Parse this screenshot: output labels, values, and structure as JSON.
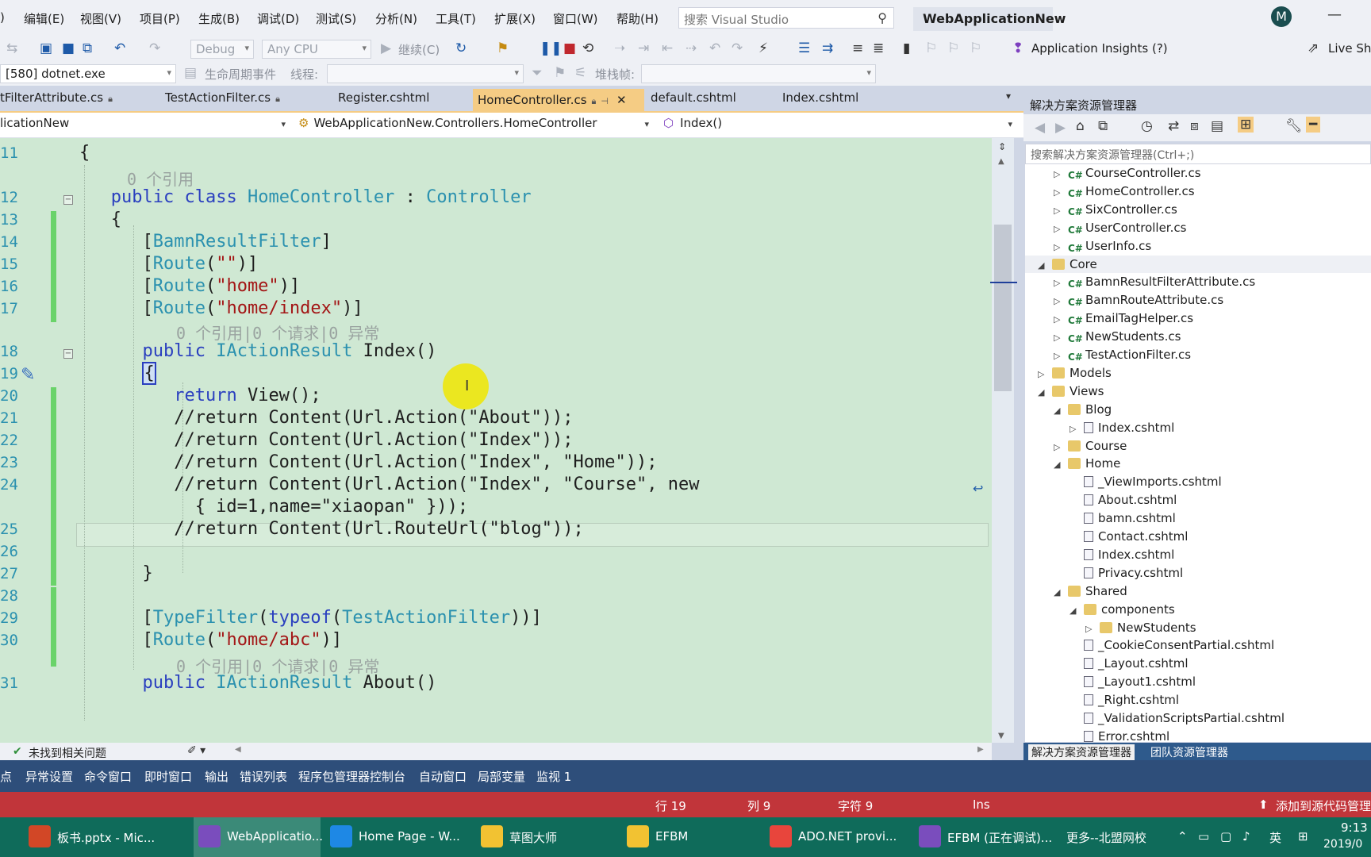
{
  "menu": {
    "items": [
      ")",
      "编辑(E)",
      "视图(V)",
      "项目(P)",
      "生成(B)",
      "调试(D)",
      "测试(S)",
      "分析(N)",
      "工具(T)",
      "扩展(X)",
      "窗口(W)",
      "帮助(H)"
    ],
    "search_placeholder": "搜索 Visual Studio",
    "project_name": "WebApplicationNew",
    "avatar_initial": "M"
  },
  "toolbar": {
    "config": "Debug",
    "platform": "Any CPU",
    "continue_label": "继续(C)",
    "insights_label": "Application Insights (?)",
    "live_share": "Live Sha",
    "process": "[580] dotnet.exe",
    "lifecycle_label": "生命周期事件",
    "thread_label": "线程:",
    "stack_label": "堆栈帧:"
  },
  "tabs": [
    {
      "label": "tFilterAttribute.cs",
      "pinned": true
    },
    {
      "label": "TestActionFilter.cs",
      "pinned": true
    },
    {
      "label": "Register.cshtml",
      "pinned": false
    },
    {
      "label": "HomeController.cs",
      "pinned": true,
      "active": true
    },
    {
      "label": "default.cshtml",
      "pinned": false
    },
    {
      "label": "Index.cshtml",
      "pinned": false
    }
  ],
  "navbar": {
    "project": "licationNew",
    "class": "WebApplicationNew.Controllers.HomeController",
    "member": "Index()"
  },
  "code": {
    "line_numbers": [
      "11",
      "12",
      "13",
      "14",
      "15",
      "16",
      "17",
      "18",
      "19",
      "20",
      "21",
      "22",
      "23",
      "24",
      "25",
      "26",
      "27",
      "28",
      "29",
      "30",
      "31"
    ],
    "lens_class": "0 个引用",
    "lens_method": "0 个引用|0 个请求|0 异常",
    "lens_method2": "0 个引用|0 个请求|0 异常"
  },
  "solution": {
    "title": "解决方案资源管理器",
    "search_placeholder": "搜索解决方案资源管理器(Ctrl+;)",
    "items": [
      {
        "label": "CourseController.cs",
        "type": "cs",
        "expander": "▷"
      },
      {
        "label": "HomeController.cs",
        "type": "cs",
        "expander": "▷"
      },
      {
        "label": "SixController.cs",
        "type": "cs",
        "expander": "▷"
      },
      {
        "label": "UserController.cs",
        "type": "cs",
        "expander": "▷"
      },
      {
        "label": "UserInfo.cs",
        "type": "cs",
        "expander": "▷"
      },
      {
        "label": "Core",
        "type": "folder",
        "expander": "◢"
      },
      {
        "label": "BamnResultFilterAttribute.cs",
        "type": "cs",
        "expander": "▷"
      },
      {
        "label": "BamnRouteAttribute.cs",
        "type": "cs",
        "expander": "▷"
      },
      {
        "label": "EmailTagHelper.cs",
        "type": "cs",
        "expander": "▷"
      },
      {
        "label": "NewStudents.cs",
        "type": "cs",
        "expander": "▷"
      },
      {
        "label": "TestActionFilter.cs",
        "type": "cs",
        "expander": "▷"
      },
      {
        "label": "Models",
        "type": "folder",
        "expander": "▷"
      },
      {
        "label": "Views",
        "type": "folder",
        "expander": "◢"
      },
      {
        "label": "Blog",
        "type": "folder",
        "expander": "◢"
      },
      {
        "label": "Index.cshtml",
        "type": "page",
        "expander": "▷"
      },
      {
        "label": "Course",
        "type": "folder",
        "expander": "▷"
      },
      {
        "label": "Home",
        "type": "folder",
        "expander": "◢"
      },
      {
        "label": "_ViewImports.cshtml",
        "type": "page",
        "expander": ""
      },
      {
        "label": "About.cshtml",
        "type": "page",
        "expander": ""
      },
      {
        "label": "bamn.cshtml",
        "type": "page",
        "expander": ""
      },
      {
        "label": "Contact.cshtml",
        "type": "page",
        "expander": ""
      },
      {
        "label": "Index.cshtml",
        "type": "page",
        "expander": ""
      },
      {
        "label": "Privacy.cshtml",
        "type": "page",
        "expander": ""
      },
      {
        "label": "Shared",
        "type": "folder",
        "expander": "◢"
      },
      {
        "label": "components",
        "type": "folder",
        "expander": "◢"
      },
      {
        "label": "NewStudents",
        "type": "folder",
        "expander": "▷"
      },
      {
        "label": "_CookieConsentPartial.cshtml",
        "type": "page",
        "expander": ""
      },
      {
        "label": "_Layout.cshtml",
        "type": "page",
        "expander": ""
      },
      {
        "label": "_Layout1.cshtml",
        "type": "page",
        "expander": ""
      },
      {
        "label": "_Right.cshtml",
        "type": "page",
        "expander": ""
      },
      {
        "label": "_ValidationScriptsPartial.cshtml",
        "type": "page",
        "expander": ""
      },
      {
        "label": "Error.cshtml",
        "type": "page",
        "expander": ""
      }
    ],
    "bottom_tabs": [
      "解决方案资源管理器",
      "团队资源管理器"
    ]
  },
  "editor_status": {
    "issues": "未找到相关问题"
  },
  "tool_tabs": [
    "点",
    "异常设置",
    "命令窗口",
    "即时窗口",
    "输出",
    "错误列表",
    "程序包管理器控制台",
    "自动窗口",
    "局部变量",
    "监视 1"
  ],
  "statusbar": {
    "line": "行 19",
    "col": "列 9",
    "char": "字符 9",
    "ins": "Ins",
    "source_control": "添加到源代码管理"
  },
  "taskbar": {
    "items": [
      {
        "label": "板书.pptx - Mic...",
        "color": "#d24726"
      },
      {
        "label": "WebApplicatio...",
        "color": "#7a4dbd",
        "active": true
      },
      {
        "label": "Home Page - W...",
        "color": "#1e88e5"
      },
      {
        "label": "草图大师",
        "color": "#f2c232"
      },
      {
        "label": "EFBM",
        "color": "#f2c232"
      },
      {
        "label": "ADO.NET provi...",
        "color": "#e8453c"
      },
      {
        "label": "EFBM (正在调试)...",
        "color": "#7a4dbd"
      }
    ],
    "more": "更多--北盟网校",
    "lang": "英",
    "time": "9:13",
    "date": "2019/0"
  },
  "colors": {
    "editor_bg": "#cfe8d3",
    "keyword": "#2a3fbf",
    "type": "#2b91af",
    "string": "#a31515",
    "active_tab": "#f5cc84",
    "statusbar": "#c1353a",
    "taskbar": "#0f6b5a"
  }
}
